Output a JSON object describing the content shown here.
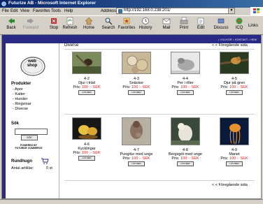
{
  "window": {
    "title": "Futurize AB - Microsoft Internet Explorer"
  },
  "menu": [
    "File",
    "Edit",
    "View",
    "Favorites",
    "Tools",
    "Help"
  ],
  "address": {
    "label": "Address",
    "url": "http://192.168.0.238:201/"
  },
  "toolbar": {
    "back": "Back",
    "forward": "Forward",
    "stop": "Stop",
    "refresh": "Refresh",
    "home": "Home",
    "search": "Search",
    "favorites": "Favorites",
    "history": "History",
    "mail": "Mail",
    "print": "Print",
    "edit": "Edit",
    "discuss": "Discuss",
    "icq": "ICQ",
    "links": "Links"
  },
  "site": {
    "top_links": "• VILLKOR     • KONTAKT     • HEM",
    "logo": "web shop",
    "products_heading": "Produkter",
    "categories": [
      "- Apor",
      "- Katter",
      "- Hunder",
      "- Ringvinar",
      "- Diverse"
    ],
    "search_heading": "Sök",
    "search_button": "SÖK",
    "powered": "POWERED BY FUTURIZE COMMERCE",
    "cart_heading": "Rundhugn",
    "cart_label": "Antal artiklar:",
    "cart_count": "0 st"
  },
  "main": {
    "section": "Diverse",
    "prev": "< < Föregående sida",
    "price_label": "Pris:",
    "more": "LÄS MER",
    "products": [
      {
        "num": "4-2",
        "name": "Djur i träd",
        "price": "100 :- SEK"
      },
      {
        "num": "4-3",
        "name": "Snäckor",
        "price": "100 :- SEK"
      },
      {
        "num": "4-4",
        "name": "Per i riller",
        "price": "100 :- SEK"
      },
      {
        "num": "4-5",
        "name": "Djur på gren",
        "price": "100 :- SEK"
      },
      {
        "num": "4-6",
        "name": "Kycklingar",
        "price": "100 :- SEK"
      },
      {
        "num": "4-7",
        "name": "Pungdur med unge",
        "price": "100 :- SEK"
      },
      {
        "num": "4-8",
        "name": "Bergsgöt med unge",
        "price": "100 :- SEK"
      },
      {
        "num": "4-9",
        "name": "Manet",
        "price": "100 :- SEK"
      }
    ]
  }
}
